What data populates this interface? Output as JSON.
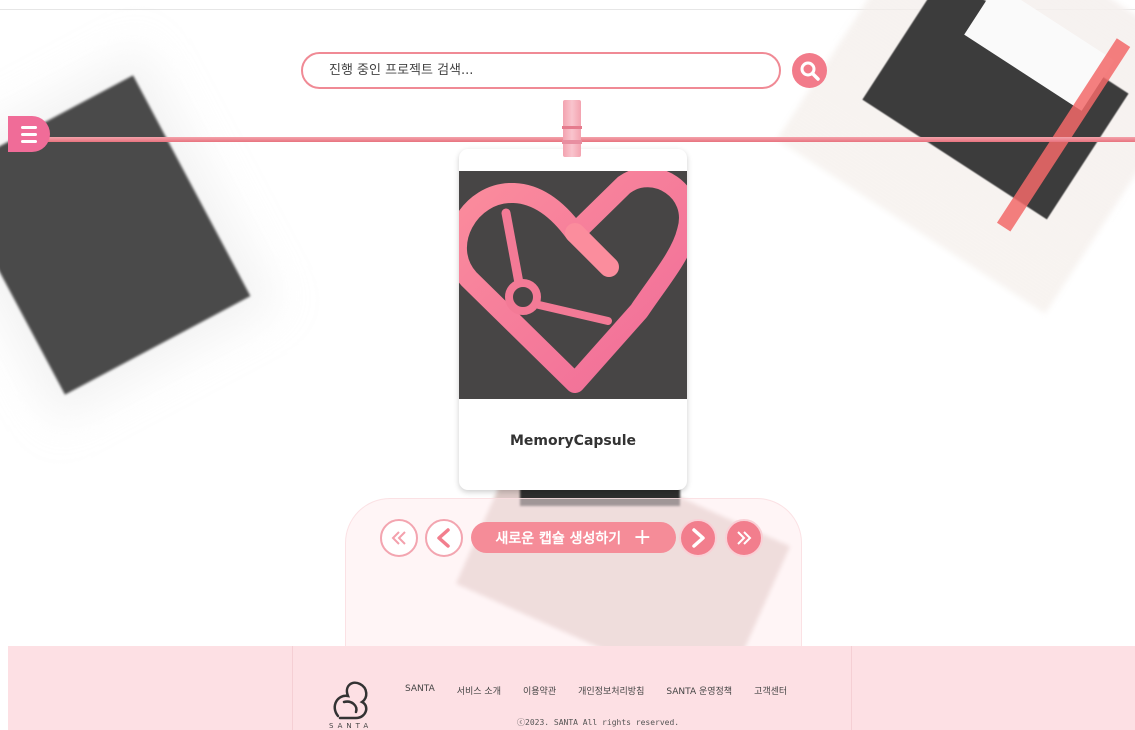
{
  "search": {
    "placeholder": "진행 중인 프로젝트 검색...",
    "button_icon": "search-icon"
  },
  "menu": {
    "icon": "hamburger-menu-icon"
  },
  "capsule_card": {
    "title": "MemoryCapsule",
    "image_icon": "heart-clock-icon",
    "accent_color": "#f06c98"
  },
  "controls": {
    "first_icon": "double-chevron-left-icon",
    "prev_icon": "chevron-left-icon",
    "create_label": "새로운 캡슐 생성하기",
    "create_icon": "plus-icon",
    "next_icon": "chevron-right-icon",
    "last_icon": "double-chevron-right-icon"
  },
  "footer": {
    "logo_text": "SANTA",
    "links": [
      "SANTA",
      "서비스 소개",
      "이용약관",
      "개인정보처리방침",
      "SANTA 운영정책",
      "고객센터"
    ],
    "copyright": "ⓒ2023. SANTA All rights reserved."
  },
  "colors": {
    "primary_pink": "#f27e8d",
    "light_pink": "#fde0e4",
    "rope": "#e8737f"
  }
}
